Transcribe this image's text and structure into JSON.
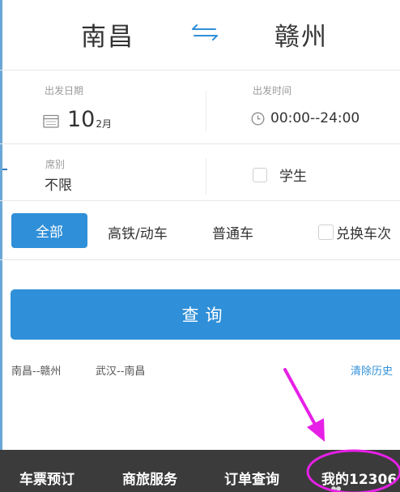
{
  "route": {
    "from_city": "南昌",
    "to_city": "赣州",
    "swap_icon": "swap-arrows-icon"
  },
  "date": {
    "label": "出发日期",
    "day": "10",
    "month": "2月",
    "icon": "calendar-icon"
  },
  "time": {
    "label": "出发时间",
    "value": "00:00--24:00",
    "icon": "clock-icon"
  },
  "seat": {
    "label": "席别",
    "value": "不限"
  },
  "student": {
    "label": "学生",
    "checked": false
  },
  "filters": {
    "all": "全部",
    "high_speed": "高铁/动车",
    "normal": "普通车",
    "exchange_label": "兑换车次",
    "exchange_checked": false
  },
  "query_button": "查询",
  "history": {
    "items": [
      "南昌--赣州",
      "武汉--南昌"
    ],
    "clear_label": "清除历史"
  },
  "tabs": [
    "车票预订",
    "商旅服务",
    "订单查询",
    "我的12306"
  ],
  "colors": {
    "accent": "#2f8fd8",
    "tabbar": "#3b3b3b",
    "annotation": "#e620e6"
  }
}
